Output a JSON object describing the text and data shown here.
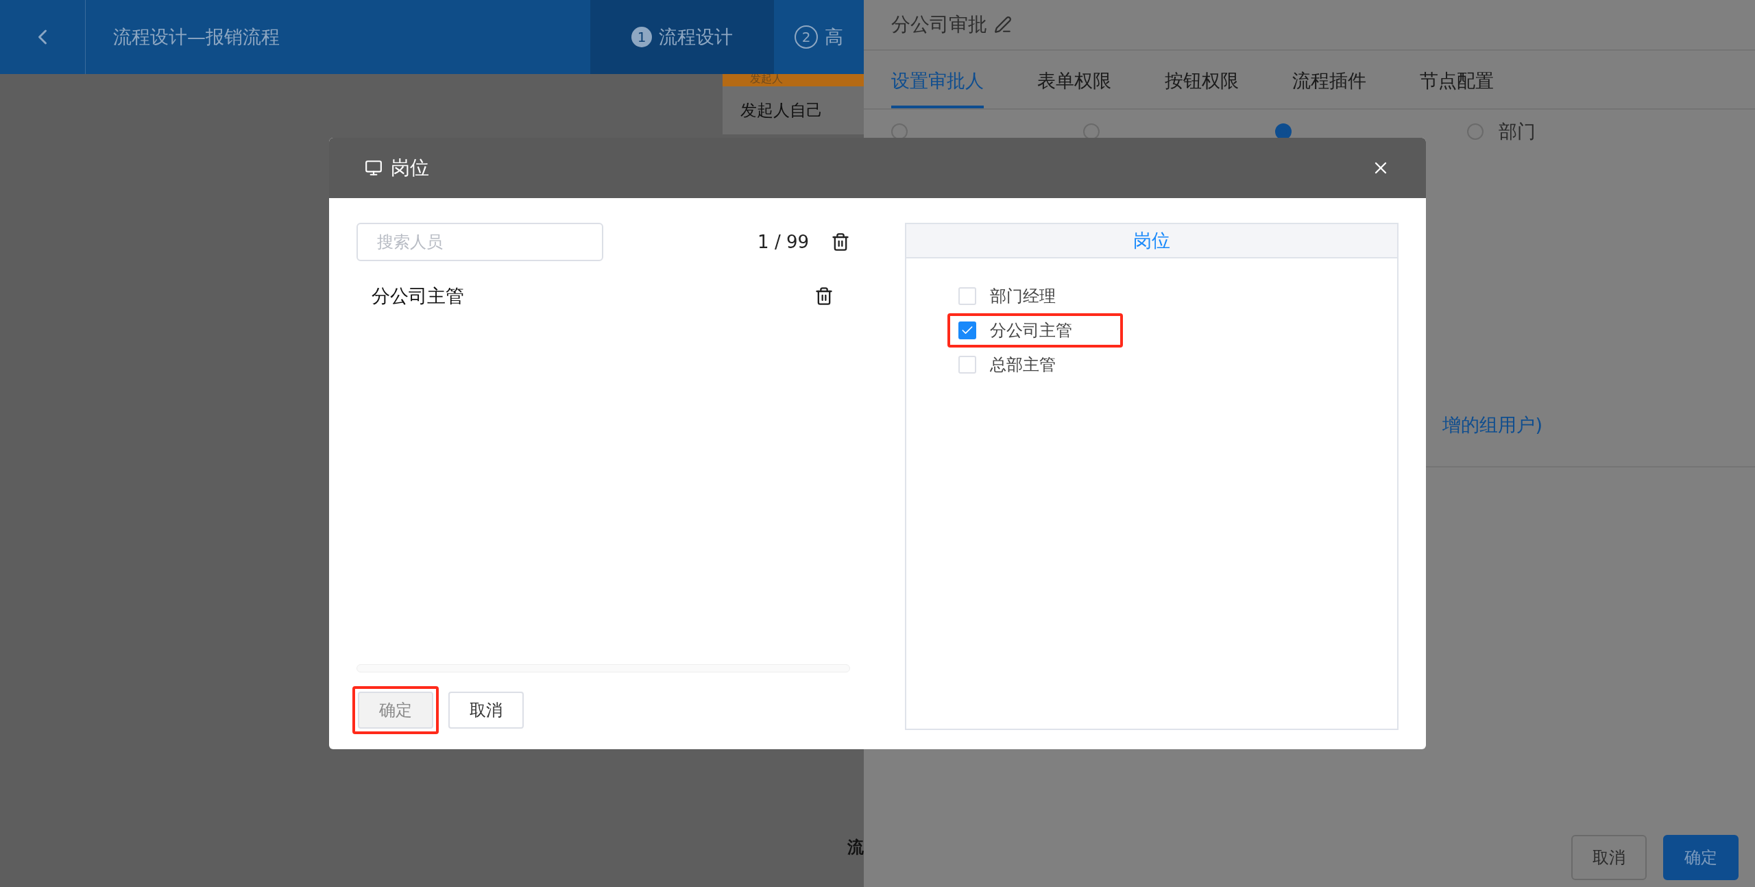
{
  "header": {
    "title": "流程设计—报销流程",
    "steps": [
      {
        "number": "1",
        "label": "流程设计",
        "selected": true
      },
      {
        "number": "2",
        "label": "高",
        "selected": false
      }
    ]
  },
  "canvas": {
    "node": {
      "header": "发起人",
      "body": "发起人自己"
    },
    "footer_text": "流"
  },
  "drawer": {
    "title": "分公司审批",
    "tabs": [
      {
        "label": "设置审批人",
        "selected": true
      },
      {
        "label": "表单权限",
        "selected": false
      },
      {
        "label": "按钮权限",
        "selected": false
      },
      {
        "label": "流程插件",
        "selected": false
      },
      {
        "label": "节点配置",
        "selected": false
      }
    ],
    "approver_types": [
      {
        "selected": false
      },
      {
        "selected": false
      },
      {
        "selected": true
      },
      {
        "label": "部门",
        "selected": false
      }
    ],
    "note": "增的组用户)",
    "buttons": [
      {
        "label": "取消",
        "kind": "default"
      },
      {
        "label": "确定",
        "kind": "primary"
      }
    ]
  },
  "dialog": {
    "title": "岗位",
    "search": {
      "placeholder": "搜索人员"
    },
    "count": "1 / 99",
    "selected_items": [
      "分公司主管"
    ],
    "buttons": [
      {
        "label": "确定",
        "disabled": true,
        "annotated": true
      },
      {
        "label": "取消",
        "disabled": false,
        "annotated": false
      }
    ],
    "panel": {
      "title": "岗位",
      "options": [
        {
          "label": "部门经理",
          "checked": false,
          "annotated": false
        },
        {
          "label": "分公司主管",
          "checked": true,
          "annotated": true
        },
        {
          "label": "总部主管",
          "checked": false,
          "annotated": false
        }
      ]
    }
  }
}
